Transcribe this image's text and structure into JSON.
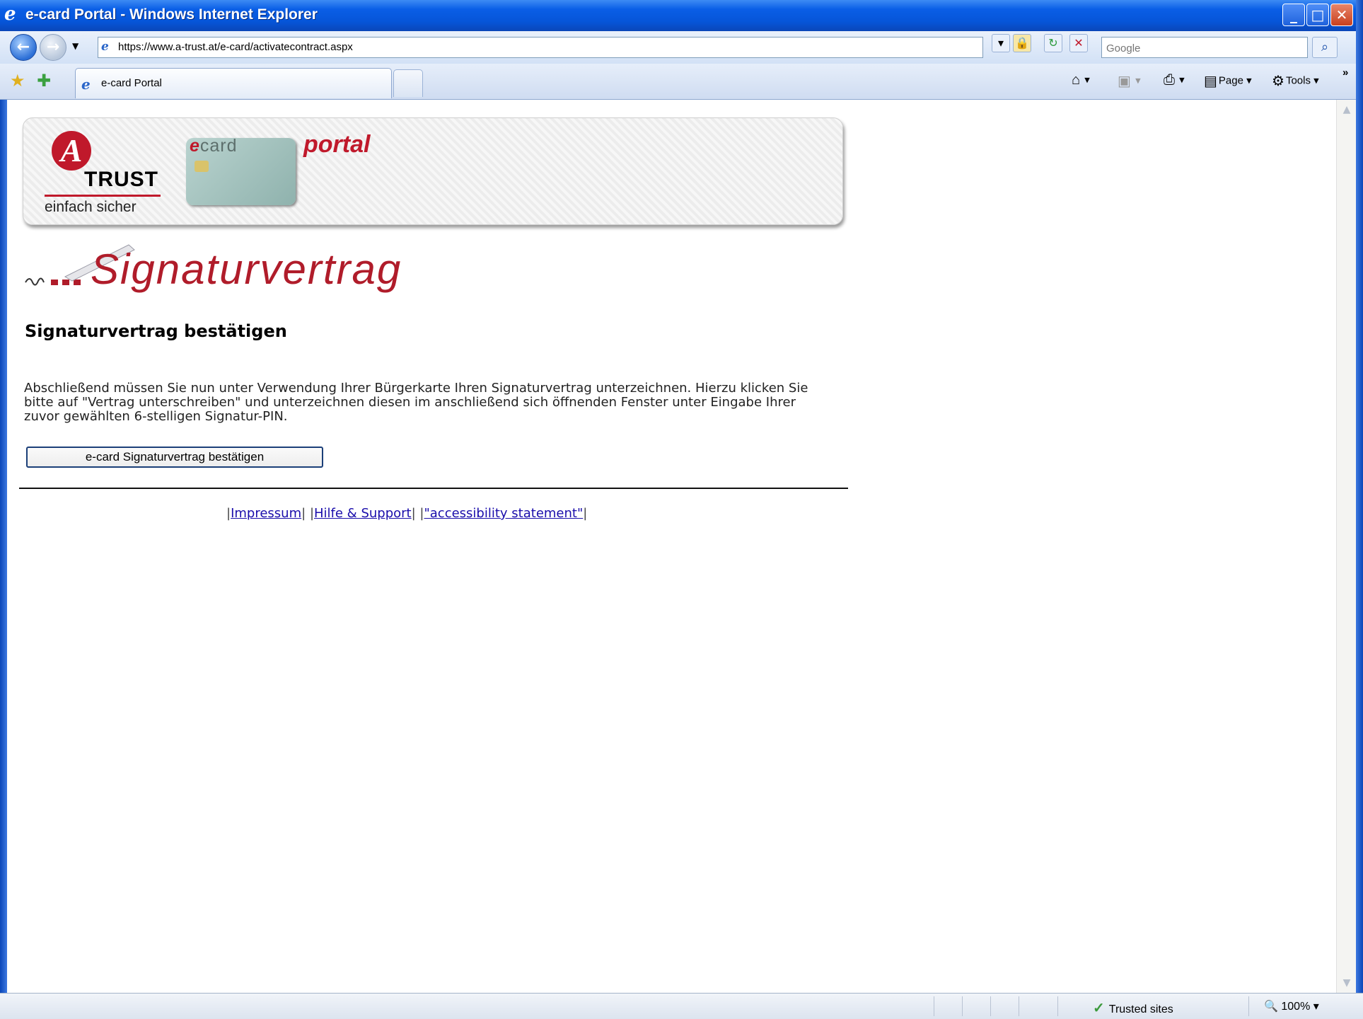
{
  "window": {
    "title": "e-card Portal - Windows Internet Explorer"
  },
  "address": {
    "url": "https://www.a-trust.at/e-card/activatecontract.aspx"
  },
  "search": {
    "placeholder": "Google"
  },
  "tab": {
    "label": "e-card Portal"
  },
  "commands": {
    "page": "Page",
    "tools": "Tools"
  },
  "banner": {
    "logo_name": "TRUST",
    "logo_letter": "A",
    "logo_tagline": "einfach sicher",
    "ecard_prefix": "e",
    "ecard_suffix": "card",
    "portal": "portal"
  },
  "page": {
    "section_title": "Signaturvertrag",
    "heading": "Signaturvertrag bestätigen",
    "intro": "Abschließend müssen Sie nun unter Verwendung Ihrer Bürgerkarte Ihren Signaturvertrag unterzeichnen. Hierzu klicken Sie bitte auf \"Vertrag unterschreiben\" und unterzeichnen diesen im anschließend sich öffnenden Fenster unter Eingabe Ihrer zuvor gewählten 6-stelligen Signatur-PIN.",
    "confirm_button": "e-card Signaturvertrag bestätigen"
  },
  "footer": {
    "pipe": "|",
    "links": [
      "Impressum",
      "Hilfe & Support",
      "\"accessibility statement\""
    ]
  },
  "status": {
    "zone": "Trusted sites",
    "zoom": "100%"
  },
  "colors": {
    "brand_red": "#c0192b",
    "link": "#1a0dab",
    "xp_blue": "#0655d8"
  }
}
